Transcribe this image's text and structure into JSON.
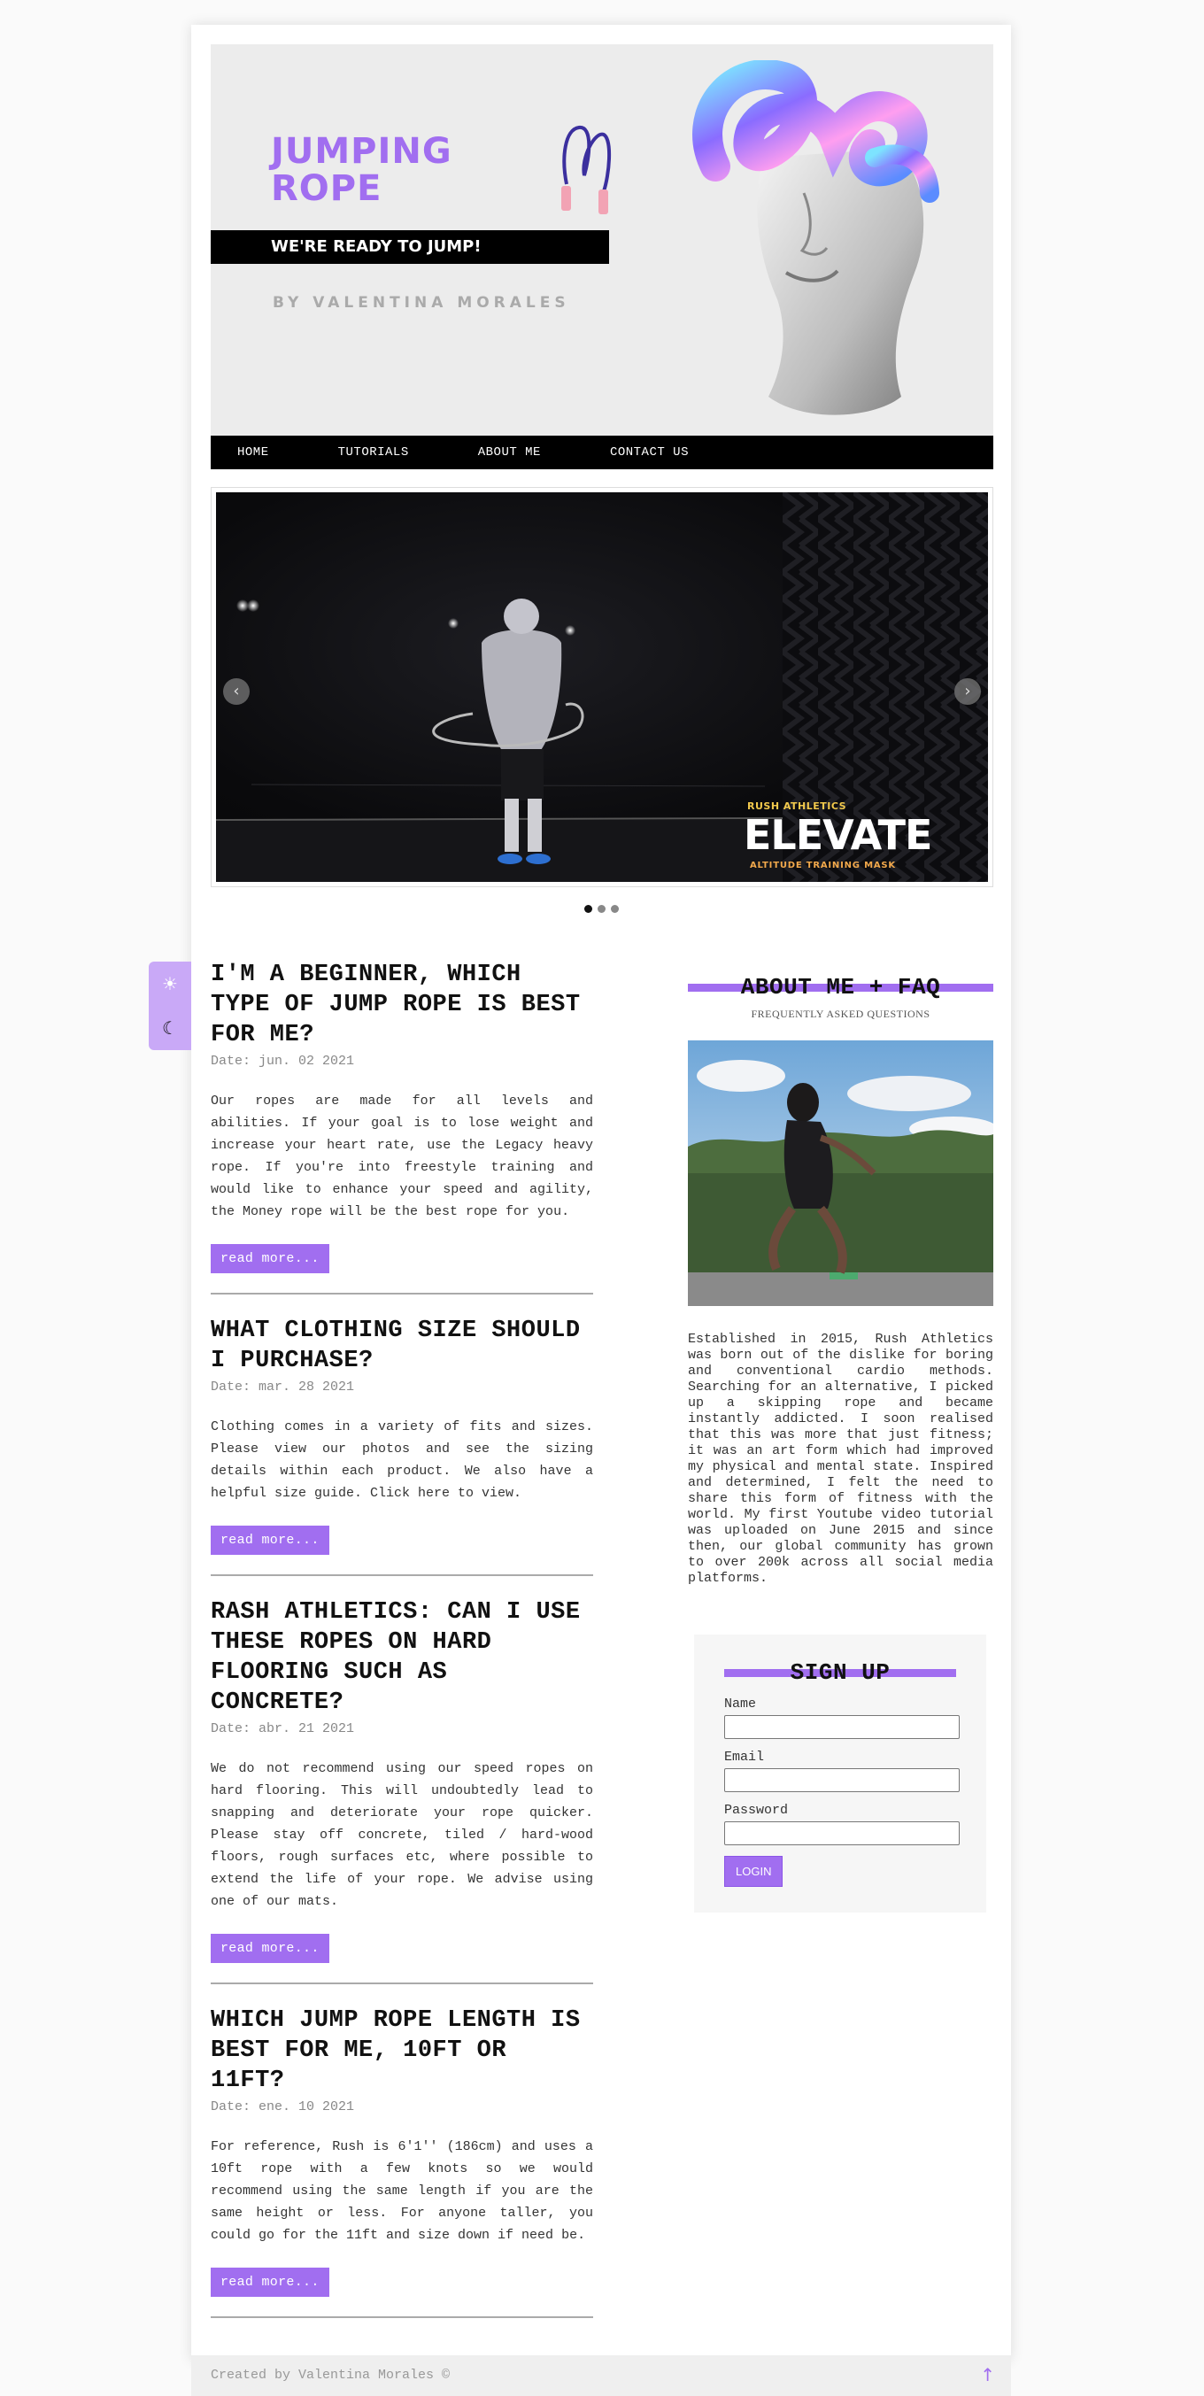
{
  "header": {
    "title": "JUMPING ROPE",
    "tagline": "WE'RE READY TO JUMP!",
    "byline": "BY VALENTINA MORALES"
  },
  "nav": {
    "items": [
      "HOME",
      "TUTORIALS",
      "ABOUT ME",
      "CONTACT US"
    ]
  },
  "carousel": {
    "promo_brand": "RUSH ATHLETICS",
    "promo_title": "ELEVATE",
    "promo_subtitle": "ALTITUDE TRAINING MASK",
    "prev_icon": "chevron-left-icon",
    "next_icon": "chevron-right-icon",
    "slide_count": 3,
    "active_slide": 1
  },
  "theme_toggle": {
    "light_icon": "sun-icon",
    "dark_icon": "moon-icon"
  },
  "posts": [
    {
      "title": "I'M A BEGINNER, WHICH TYPE OF JUMP ROPE IS BEST FOR ME?",
      "date": "Date: jun. 02 2021",
      "body": "Our ropes are made for all levels and abilities. If your goal is to lose weight and increase your heart rate, use the Legacy heavy rope. If you're into freestyle training and would like to enhance your speed and agility, the Money rope will be the best rope for you.",
      "cta": "read more..."
    },
    {
      "title": "WHAT CLOTHING SIZE SHOULD I PURCHASE?",
      "date": "Date: mar. 28 2021",
      "body": "Clothing comes in a variety of fits and sizes. Please view our photos and see the sizing details within each product. We also have a helpful size guide. Click here to view.",
      "cta": "read more..."
    },
    {
      "title": "RASH ATHLETICS: CAN I USE THESE ROPES ON HARD FLOORING SUCH AS CONCRETE?",
      "date": "Date: abr. 21 2021",
      "body": "We do not recommend using our speed ropes on hard flooring. This will undoubtedly lead to snapping and deteriorate your rope quicker. Please stay off concrete, tiled / hard-wood floors, rough surfaces etc, where possible to extend the life of your rope. We advise using one of our mats.",
      "cta": "read more..."
    },
    {
      "title": "WHICH JUMP ROPE LENGTH IS BEST FOR ME, 10FT OR 11FT?",
      "date": "Date: ene. 10 2021",
      "body": "For reference, Rush is 6'1'' (186cm) and uses a 10ft rope with a few knots so we would recommend using the same length if you are the same height or less. For anyone taller, you could go for the 11ft and size down if need be.",
      "cta": "read more..."
    }
  ],
  "sidebar": {
    "heading": "ABOUT ME + FAQ",
    "subheading": "FREQUENTLY ASKED QUESTIONS",
    "about_text": "Established in 2015, Rush Athletics was born out of the dislike for boring and conventional cardio methods. Searching for an alternative, I picked up a skipping rope and became instantly addicted. I soon realised that this was more that just fitness; it was an art form which had improved my physical and mental state. Inspired and determined, I felt the need to share this form of fitness with the world. My first Youtube video tutorial was uploaded on June 2015 and since then, our global community has grown to over 200k across all social media platforms."
  },
  "signup": {
    "heading": "SIGN UP",
    "name_label": "Name",
    "email_label": "Email",
    "password_label": "Password",
    "name_value": "",
    "email_value": "",
    "password_value": "",
    "button": "LOGIN"
  },
  "footer": {
    "text": "Created by Valentina Morales ©",
    "to_top_icon": "arrow-up-icon"
  },
  "colors": {
    "accent": "#a16ef0",
    "header_bg": "#ececec",
    "nav_bg": "#000000",
    "toggle_bg": "#c9a9f7"
  }
}
